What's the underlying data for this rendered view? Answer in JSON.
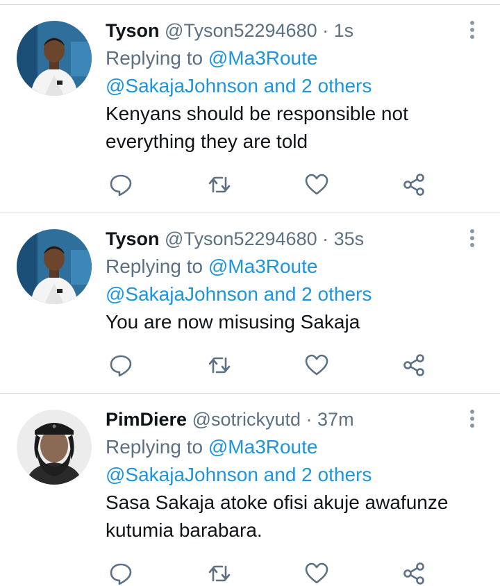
{
  "tweets": [
    {
      "name": "Tyson",
      "handle": "@Tyson52294680",
      "time": "· 1s",
      "replying_prefix": "Replying to",
      "replying_to": "@Ma3Route",
      "mentions": "@SakajaJohnson and 2 others",
      "text": "Kenyans should be responsible not everything they are told"
    },
    {
      "name": "Tyson",
      "handle": "@Tyson52294680",
      "time": "· 35s",
      "replying_prefix": "Replying to",
      "replying_to": "@Ma3Route",
      "mentions": "@SakajaJohnson and 2 others",
      "text": "You are now misusing Sakaja"
    },
    {
      "name": "PimDiere",
      "handle": "@sotrickyutd",
      "time": "· 37m",
      "replying_prefix": "Replying to",
      "replying_to": "@Ma3Route",
      "mentions": "@SakajaJohnson and 2 others",
      "text": "Sasa Sakaja atoke ofisi akuje awafunze kutumia barabara."
    }
  ],
  "icons": {
    "reply": "reply-icon",
    "retweet": "retweet-icon",
    "like": "like-icon",
    "share": "share-icon",
    "more": "more-vertical-icon"
  },
  "colors": {
    "text": "#0f1419",
    "secondary": "#5b7083",
    "link": "#1b95e0",
    "icon": "#5b7083",
    "divider": "#dadfe3"
  }
}
